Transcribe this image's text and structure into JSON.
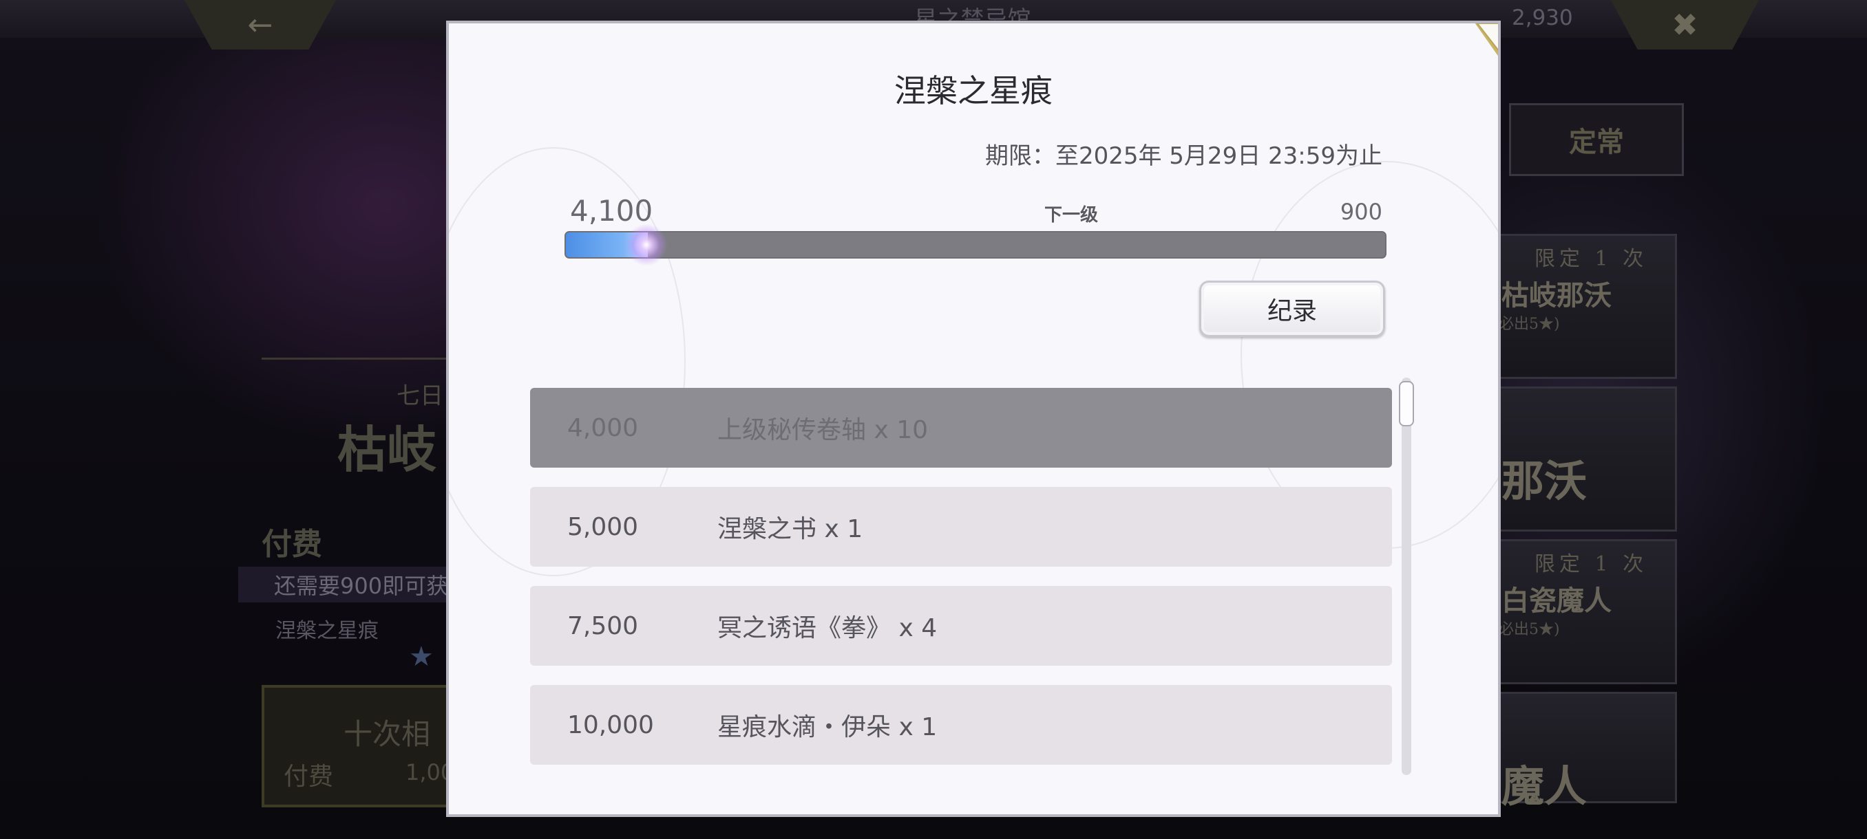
{
  "background": {
    "top_tabs": [
      "星之禁忌馆"
    ],
    "gem_count": "2,930",
    "right_tab": "定常",
    "banners": [
      {
        "limit": "限定 1 次",
        "name": "枯岐那沃",
        "sub": "必出5★)"
      },
      {
        "limit": "",
        "name": "那沃",
        "sub": ""
      },
      {
        "limit": "限定 1 次",
        "name": "白瓷魔人",
        "sub": "必出5★)"
      },
      {
        "limit": "",
        "name": "魔人",
        "sub": ""
      }
    ],
    "left": {
      "title_small": "七日",
      "title_big": "枯岐",
      "paid": "付费",
      "need_text": "还需要900即可获",
      "name": "涅槃之星痕",
      "ten_pull": "十次相",
      "paid_label": "付费",
      "cost": "1,00"
    }
  },
  "modal": {
    "title": "涅槃之星痕",
    "period": "期限：至2025年 5月29日 23:59为止",
    "current_points": "4,100",
    "next_label": "下一级",
    "next_points": "900",
    "progress_fraction": 0.1,
    "record_button": "纪录",
    "rewards": [
      {
        "points": "4,000",
        "reward": "上级秘传卷轴 x 10",
        "claimed": true
      },
      {
        "points": "5,000",
        "reward": "涅槃之书 x 1",
        "claimed": false
      },
      {
        "points": "7,500",
        "reward": "冥之诱语《拳》 x 4",
        "claimed": false
      },
      {
        "points": "10,000",
        "reward": "星痕水滴・伊朵 x 1",
        "claimed": false
      }
    ]
  },
  "icons": {
    "back": "back-arrow-icon",
    "close": "close-x-icon",
    "gem": "gem-icon"
  },
  "colors": {
    "progress_fill": "#5a9ae9",
    "claimed_row": "#8e8d93",
    "row": "#e5e1e7"
  }
}
